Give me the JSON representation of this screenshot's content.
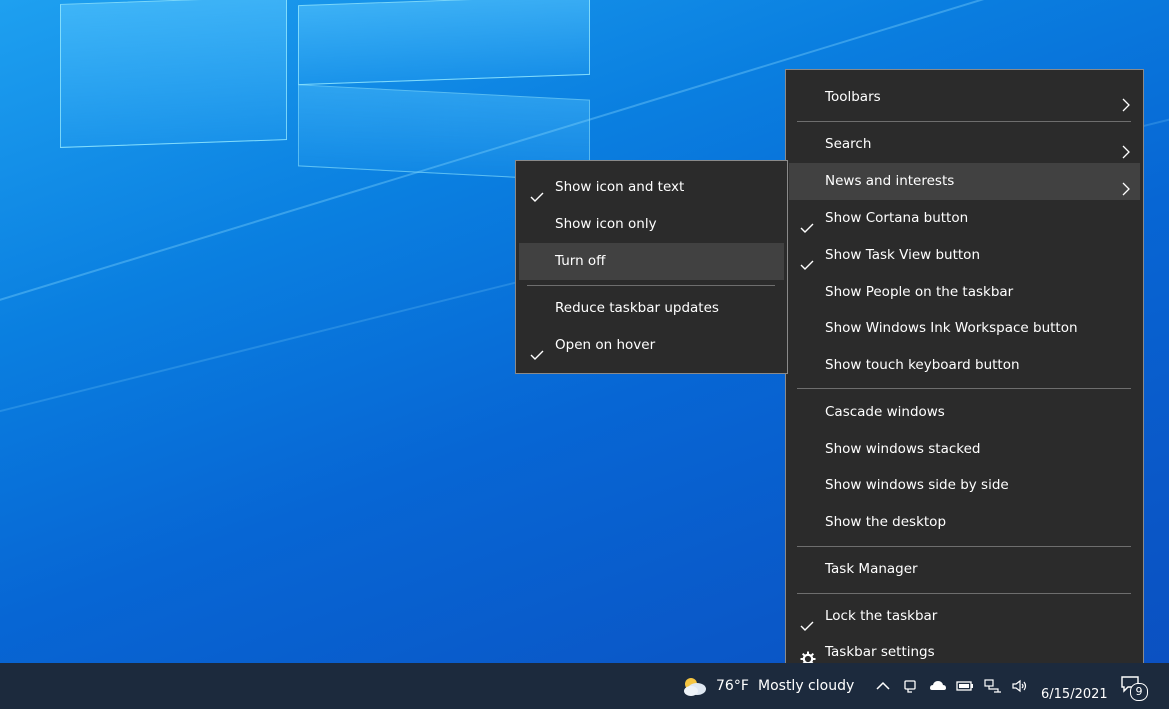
{
  "context_menu": {
    "items": [
      {
        "label": "Toolbars",
        "checked": false,
        "submenu": true
      },
      {
        "label": "Search",
        "checked": false,
        "submenu": true
      },
      {
        "label": "News and interests",
        "checked": false,
        "submenu": true,
        "highlighted": true
      },
      {
        "label": "Show Cortana button",
        "checked": true
      },
      {
        "label": "Show Task View button",
        "checked": true
      },
      {
        "label": "Show People on the taskbar",
        "checked": false
      },
      {
        "label": "Show Windows Ink Workspace button",
        "checked": false
      },
      {
        "label": "Show touch keyboard button",
        "checked": false
      },
      {
        "label": "Cascade windows",
        "checked": false
      },
      {
        "label": "Show windows stacked",
        "checked": false
      },
      {
        "label": "Show windows side by side",
        "checked": false
      },
      {
        "label": "Show the desktop",
        "checked": false
      },
      {
        "label": "Task Manager",
        "checked": false
      },
      {
        "label": "Lock the taskbar",
        "checked": true
      },
      {
        "label": "Taskbar settings",
        "icon": "gear-icon"
      }
    ]
  },
  "news_submenu": {
    "items": [
      {
        "label": "Show icon and text",
        "checked": true
      },
      {
        "label": "Show icon only",
        "checked": false
      },
      {
        "label": "Turn off",
        "checked": false,
        "highlighted": true
      },
      {
        "label": "Reduce taskbar updates",
        "checked": false
      },
      {
        "label": "Open on hover",
        "checked": true
      }
    ]
  },
  "taskbar": {
    "weather": {
      "temperature": "76°F",
      "condition": "Mostly cloudy",
      "icon": "partly-cloudy-icon"
    },
    "tray_icons": [
      "chevron-up-icon",
      "meet-now-icon",
      "onedrive-icon",
      "battery-icon",
      "network-icon",
      "volume-icon"
    ],
    "date": "6/15/2021",
    "notification_count": "9"
  },
  "colors": {
    "menu_bg": "#2b2b2b",
    "menu_highlight": "#414141",
    "taskbar_bg": "#1c2a3d",
    "desktop_blue": "#0766d4"
  }
}
